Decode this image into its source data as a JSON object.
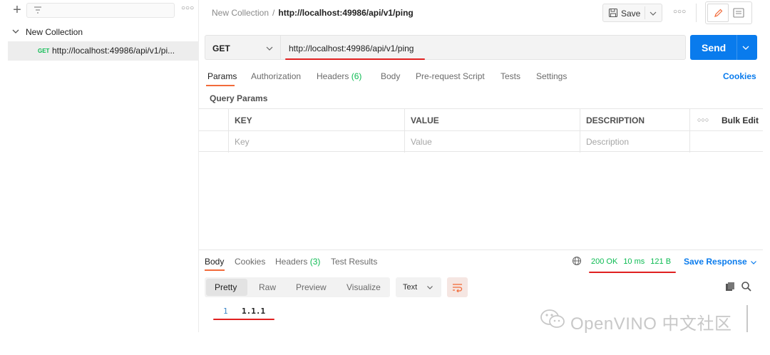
{
  "sidebar": {
    "collection_name": "New Collection",
    "request": {
      "method": "GET",
      "url": "http://localhost:49986/api/v1/pi..."
    }
  },
  "header": {
    "breadcrumb_parent": "New Collection",
    "breadcrumb_separator": "/",
    "breadcrumb_current": "http://localhost:49986/api/v1/ping",
    "save_label": "Save"
  },
  "request": {
    "method": "GET",
    "url": "http://localhost:49986/api/v1/ping",
    "send_label": "Send",
    "tabs": [
      {
        "label": "Params"
      },
      {
        "label": "Authorization"
      },
      {
        "label": "Headers",
        "count": "(6)"
      },
      {
        "label": "Body"
      },
      {
        "label": "Pre-request Script"
      },
      {
        "label": "Tests"
      },
      {
        "label": "Settings"
      }
    ],
    "cookies_label": "Cookies",
    "query_params_label": "Query Params",
    "table": {
      "headers": [
        "KEY",
        "VALUE",
        "DESCRIPTION"
      ],
      "bulk_edit_label": "Bulk Edit",
      "placeholders": [
        "Key",
        "Value",
        "Description"
      ]
    }
  },
  "response": {
    "tabs": [
      {
        "label": "Body"
      },
      {
        "label": "Cookies"
      },
      {
        "label": "Headers",
        "count": "(3)"
      },
      {
        "label": "Test Results"
      }
    ],
    "status": "200 OK",
    "time": "10 ms",
    "size": "121 B",
    "save_response_label": "Save Response",
    "formats": [
      "Pretty",
      "Raw",
      "Preview",
      "Visualize"
    ],
    "text_type": "Text",
    "lines": [
      {
        "num": "1",
        "code": "1.1.1"
      }
    ]
  },
  "watermark": {
    "text": "OpenVINO 中文社区"
  },
  "colors": {
    "accent": "#097bed",
    "success": "#0cbb52",
    "tab_active": "#f26b3a",
    "annotation": "#e02020"
  }
}
